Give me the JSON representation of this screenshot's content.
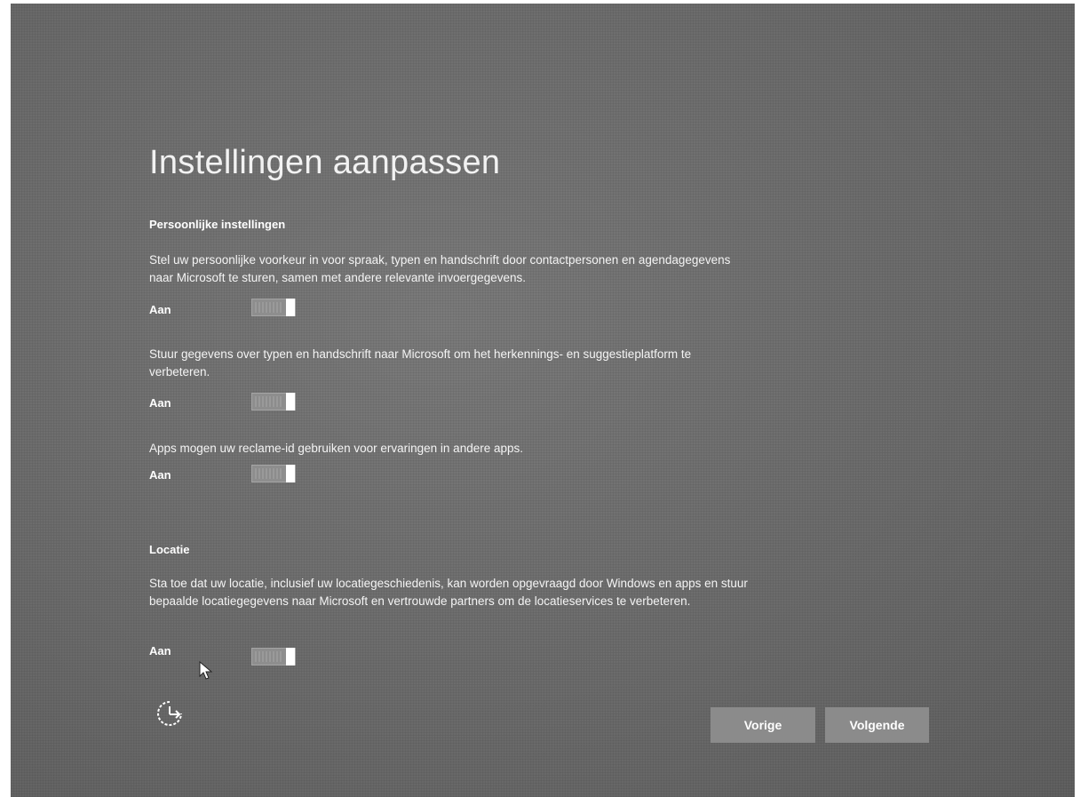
{
  "page": {
    "title": "Instellingen aanpassen"
  },
  "personal": {
    "heading": "Persoonlijke instellingen",
    "settings": [
      {
        "description": "Stel uw persoonlijke voorkeur in voor spraak, typen en handschrift door contactpersonen en agendagegevens naar Microsoft te sturen, samen met andere relevante invoergegevens.",
        "state_label": "Aan",
        "on": true
      },
      {
        "description": "Stuur gegevens over typen en handschrift naar Microsoft om het herkennings- en suggestieplatform te verbeteren.",
        "state_label": "Aan",
        "on": true
      },
      {
        "description": "Apps mogen uw reclame-id gebruiken voor ervaringen in andere apps.",
        "state_label": "Aan",
        "on": true
      }
    ]
  },
  "location": {
    "heading": "Locatie",
    "settings": [
      {
        "description": "Sta toe dat uw locatie, inclusief uw locatiegeschiedenis, kan worden opgevraagd door Windows en apps en stuur bepaalde locatiegegevens naar Microsoft en vertrouwde partners om de locatieservices te verbeteren.",
        "state_label": "Aan",
        "on": true
      }
    ]
  },
  "footer": {
    "ease_of_access_icon": "ease-of-access-icon",
    "back_label": "Vorige",
    "next_label": "Volgende"
  },
  "colors": {
    "background": "#6c6c6c",
    "button": "#8b8b8b",
    "text": "#ffffff"
  }
}
